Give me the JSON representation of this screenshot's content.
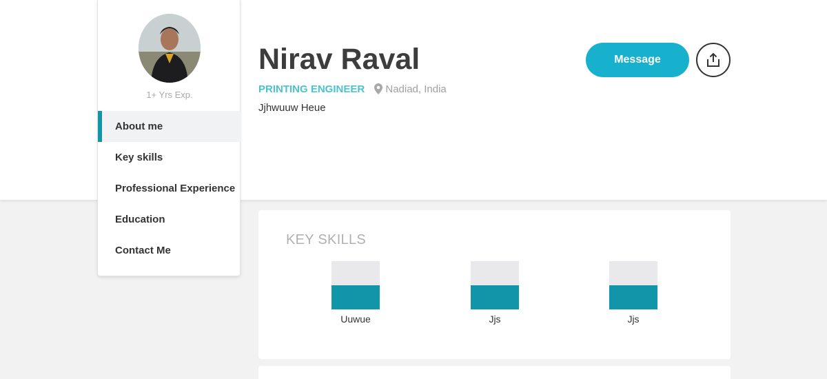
{
  "profile": {
    "experience": "1+ Yrs Exp.",
    "name": "Nirav Raval",
    "job_title": "PRINTING ENGINEER",
    "location": "Nadiad, India",
    "tagline": "Jjhwuuw Heue"
  },
  "sidebar": {
    "items": [
      {
        "label": "About me",
        "active": true
      },
      {
        "label": "Key skills",
        "active": false
      },
      {
        "label": "Professional Experience",
        "active": false
      },
      {
        "label": "Education",
        "active": false
      },
      {
        "label": "Contact Me",
        "active": false
      }
    ]
  },
  "actions": {
    "message_label": "Message",
    "share_icon": "share-upload-icon"
  },
  "key_skills": {
    "title": "KEY SKILLS",
    "skills": [
      {
        "label": "Uuwue",
        "level": 0.5
      },
      {
        "label": "Jjs",
        "level": 0.5
      },
      {
        "label": "Jjs",
        "level": 0.5
      }
    ]
  },
  "colors": {
    "accent": "#17b1cd",
    "accent_dark": "#1096a8",
    "job_title": "#4cc1cf"
  }
}
